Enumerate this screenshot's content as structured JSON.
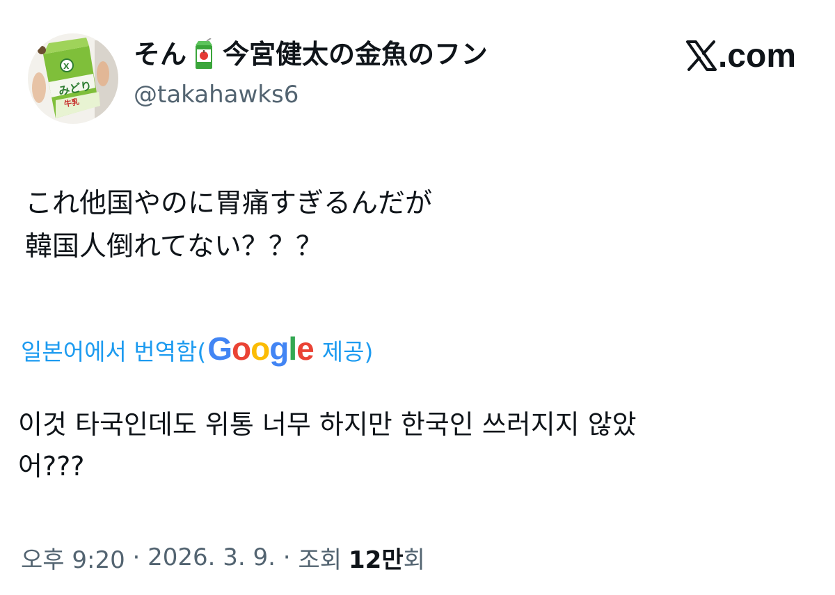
{
  "author": {
    "display_name_prefix": "そん",
    "display_name_suffix": "今宮健太の金魚のフン",
    "emoji_icon": "apple-juice-box-icon",
    "handle": "@takahawks6",
    "avatar_icon": "milk-carton-avatar-icon"
  },
  "brand": {
    "logo_icon": "x-logo-icon",
    "domain_label": ".com"
  },
  "tweet": {
    "lines": [
      "これ他国やのに胃痛すぎるんだが",
      "韓国人倒れてない？？？"
    ]
  },
  "translation": {
    "prefix": "일본어에서 번역함(",
    "provider": "Google",
    "suffix": " 제공)",
    "lines": [
      "이것 타국인데도 위통 너무 하지만 한국인 쓰러지지 않았",
      "어???"
    ]
  },
  "meta": {
    "time": "오후 9:20",
    "separator_1": " · ",
    "date": "2026. 3. 9.",
    "separator_2": " · ",
    "views_label": "조회",
    "views_count": "12만",
    "views_suffix": "회"
  },
  "colors": {
    "accent_blue": "#1d9bf0",
    "secondary_text": "#536471",
    "primary_text": "#0f1419",
    "google_blue": "#4285F4",
    "google_red": "#EA4335",
    "google_yellow": "#FBBC05",
    "google_green": "#34A853"
  }
}
